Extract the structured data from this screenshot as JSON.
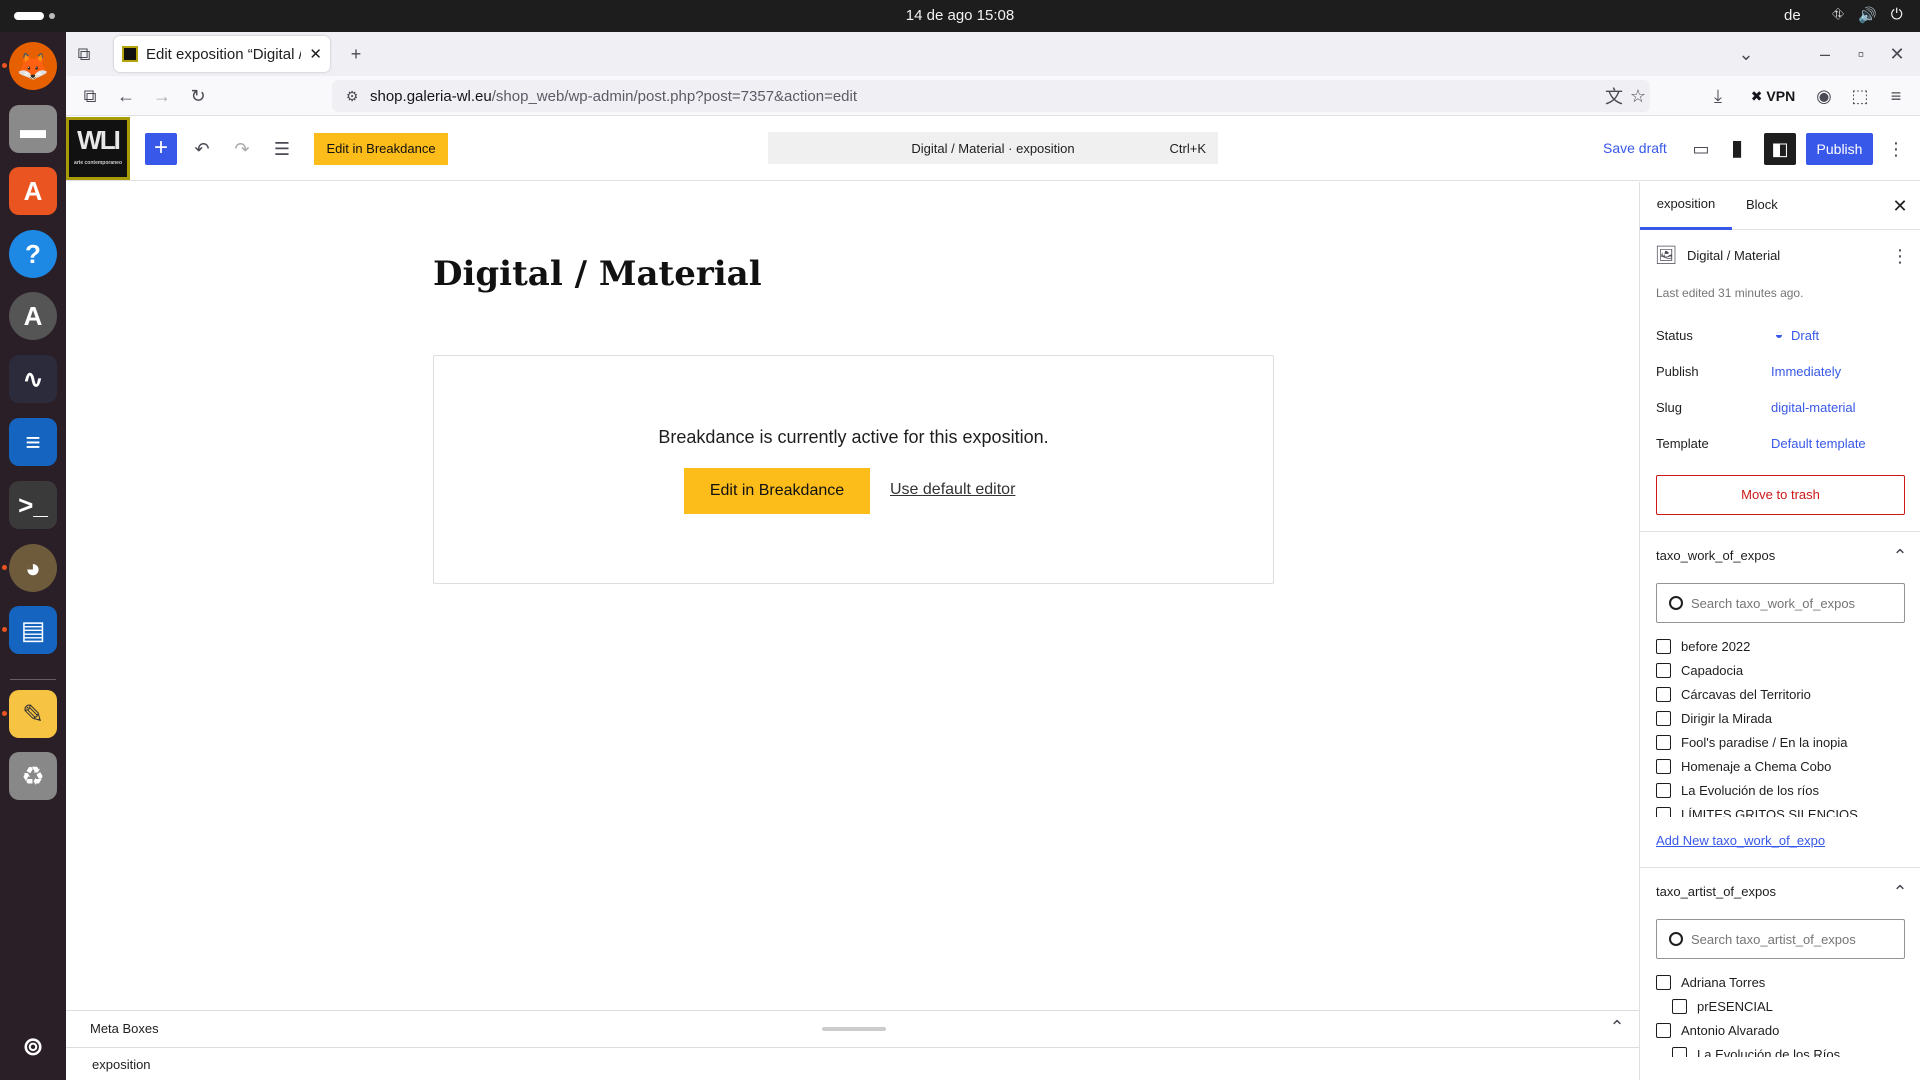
{
  "os": {
    "clock": "14 de ago  15:08",
    "lang": "de"
  },
  "browser": {
    "tab_title": "Edit exposition “Digital / M",
    "url_host": "shop.galeria-wl.eu",
    "url_path": "/shop_web/wp-admin/post.php?post=7357&action=edit",
    "vpn_label": "VPN"
  },
  "editor": {
    "logo_text": "WLI",
    "logo_sub": "arte contemporaneo",
    "edit_breakdance": "Edit in Breakdance",
    "command_title": "Digital / Material · exposition",
    "command_shortcut": "Ctrl+K",
    "save_draft": "Save draft",
    "publish": "Publish"
  },
  "canvas": {
    "post_title": "Digital / Material",
    "bd_message": "Breakdance is currently active for this exposition.",
    "bd_edit": "Edit in Breakdance",
    "bd_default": "Use default editor"
  },
  "meta": {
    "label": "Meta Boxes",
    "crumb": "exposition"
  },
  "sidebar": {
    "tab_post": "exposition",
    "tab_block": "Block",
    "post_name": "Digital / Material",
    "last_edited": "Last edited 31 minutes ago.",
    "rows": [
      {
        "label": "Status",
        "value": "Draft"
      },
      {
        "label": "Publish",
        "value": "Immediately"
      },
      {
        "label": "Slug",
        "value": "digital-material"
      },
      {
        "label": "Template",
        "value": "Default template"
      }
    ],
    "trash": "Move to trash",
    "tax1": {
      "title": "taxo_work_of_expos",
      "placeholder": "Search taxo_work_of_expos",
      "items": [
        "before 2022",
        "Capadocia",
        "Cárcavas del Territorio",
        "Dirigir la Mirada",
        "Fool's paradise / En la inopia",
        "Homenaje a Chema Cobo",
        "La Evolución de los ríos",
        "LÍMITES GRITOS SILENCIOS"
      ],
      "add_new": "Add New taxo_work_of_expo"
    },
    "tax2": {
      "title": "taxo_artist_of_expos",
      "placeholder": "Search taxo_artist_of_expos",
      "items": [
        "Adriana Torres",
        "prESENCIAL",
        "Antonio Alvarado",
        "La Evolución de los Ríos"
      ]
    }
  }
}
